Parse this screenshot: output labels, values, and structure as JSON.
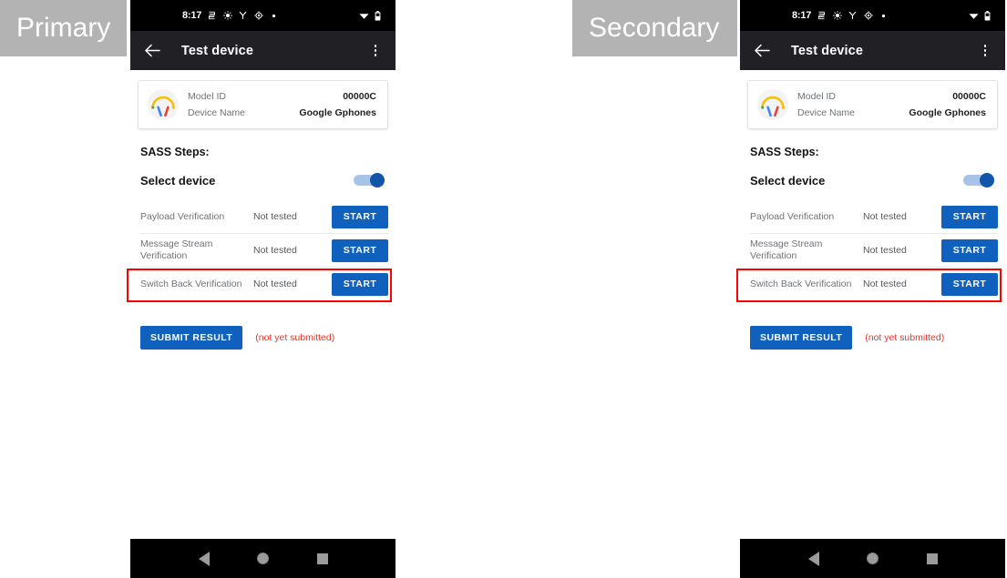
{
  "annotations": [
    {
      "id": "primary",
      "label": "Primary"
    },
    {
      "id": "secondary",
      "label": "Secondary"
    }
  ],
  "colors": {
    "accent_blue": "#1060be",
    "toggle_thumb": "#1156ab",
    "toggle_track": "#a8c3e8",
    "error_red": "#e8342a",
    "highlight_red": "#ff0000",
    "status_bar_bg": "#000000",
    "app_bar_bg": "#212125",
    "annotation_bg": "#b3b3b3",
    "muted_text": "#6f7276"
  },
  "phone": {
    "status_bar": {
      "clock": "8:17",
      "icons": [
        "sim-card-icon",
        "sync-icon",
        "vpn-icon",
        "location-icon",
        "dot-icon"
      ],
      "right_icons": [
        "wifi-icon",
        "battery-icon"
      ]
    },
    "app_bar": {
      "back_icon": "back-arrow-icon",
      "title": "Test device",
      "overflow_icon": "overflow-menu-icon"
    },
    "device_card": {
      "icon": "headphones-icon",
      "rows": [
        {
          "label": "Model ID",
          "value": "00000C"
        },
        {
          "label": "Device Name",
          "value": "Google Gphones"
        }
      ]
    },
    "sass": {
      "heading": "SASS Steps:",
      "select_device": {
        "label": "Select device",
        "toggle_state": "on"
      },
      "steps": [
        {
          "name": "Payload Verification",
          "status": "Not tested",
          "button": "START",
          "highlighted": false
        },
        {
          "name": "Message Stream Verification",
          "status": "Not tested",
          "button": "START",
          "highlighted": false
        },
        {
          "name": "Switch Back Verification",
          "status": "Not tested",
          "button": "START",
          "highlighted": true
        }
      ]
    },
    "submit": {
      "button": "SUBMIT RESULT",
      "note": "(not yet submitted)"
    },
    "nav_bar": {
      "back": "nav-back-icon",
      "home": "nav-home-icon",
      "recents": "nav-recents-icon"
    }
  }
}
